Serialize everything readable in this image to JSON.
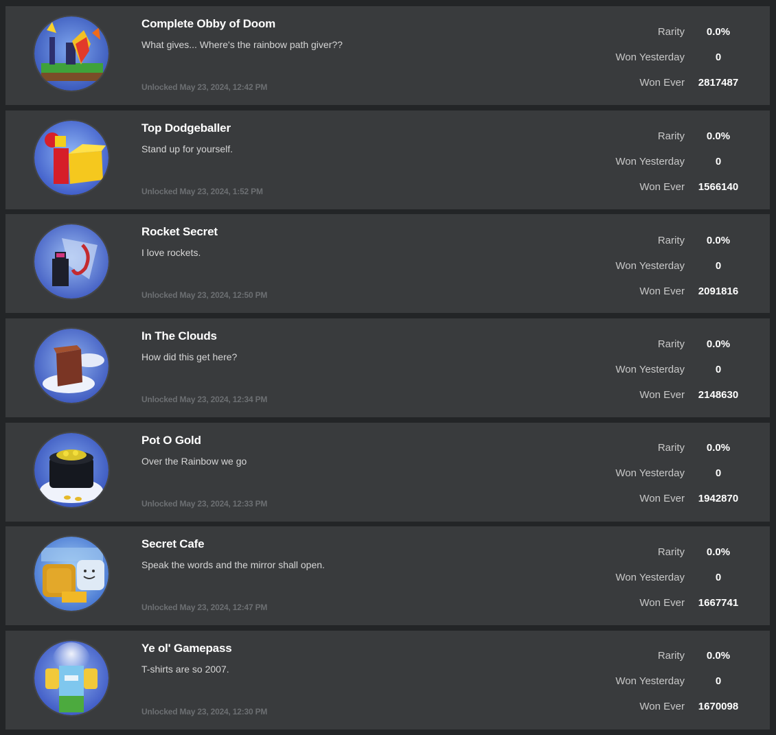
{
  "labels": {
    "rarity": "Rarity",
    "won_yesterday": "Won Yesterday",
    "won_ever": "Won Ever"
  },
  "badges": [
    {
      "name": "Complete Obby of Doom",
      "description": "What gives... Where's the rainbow path giver??",
      "unlocked": "Unlocked May 23, 2024, 12:42 PM",
      "rarity": "0.0%",
      "won_yesterday": "0",
      "won_ever": "2817487",
      "icon": "obby-of-doom-icon"
    },
    {
      "name": "Top Dodgeballer",
      "description": "Stand up for yourself.",
      "unlocked": "Unlocked May 23, 2024, 1:52 PM",
      "rarity": "0.0%",
      "won_yesterday": "0",
      "won_ever": "1566140",
      "icon": "dodgeballer-icon"
    },
    {
      "name": "Rocket Secret",
      "description": "I love rockets.",
      "unlocked": "Unlocked May 23, 2024, 12:50 PM",
      "rarity": "0.0%",
      "won_yesterday": "0",
      "won_ever": "2091816",
      "icon": "rocket-secret-icon"
    },
    {
      "name": "In The Clouds",
      "description": "How did this get here?",
      "unlocked": "Unlocked May 23, 2024, 12:34 PM",
      "rarity": "0.0%",
      "won_yesterday": "0",
      "won_ever": "2148630",
      "icon": "clouds-icon"
    },
    {
      "name": "Pot O Gold",
      "description": "Over the Rainbow we go",
      "unlocked": "Unlocked May 23, 2024, 12:33 PM",
      "rarity": "0.0%",
      "won_yesterday": "0",
      "won_ever": "1942870",
      "icon": "pot-of-gold-icon"
    },
    {
      "name": "Secret Cafe",
      "description": "Speak the words and the mirror shall open.",
      "unlocked": "Unlocked May 23, 2024, 12:47 PM",
      "rarity": "0.0%",
      "won_yesterday": "0",
      "won_ever": "1667741",
      "icon": "secret-cafe-icon"
    },
    {
      "name": "Ye ol' Gamepass",
      "description": "T-shirts are so 2007.",
      "unlocked": "Unlocked May 23, 2024, 12:30 PM",
      "rarity": "0.0%",
      "won_yesterday": "0",
      "won_ever": "1670098",
      "icon": "gamepass-icon"
    }
  ]
}
